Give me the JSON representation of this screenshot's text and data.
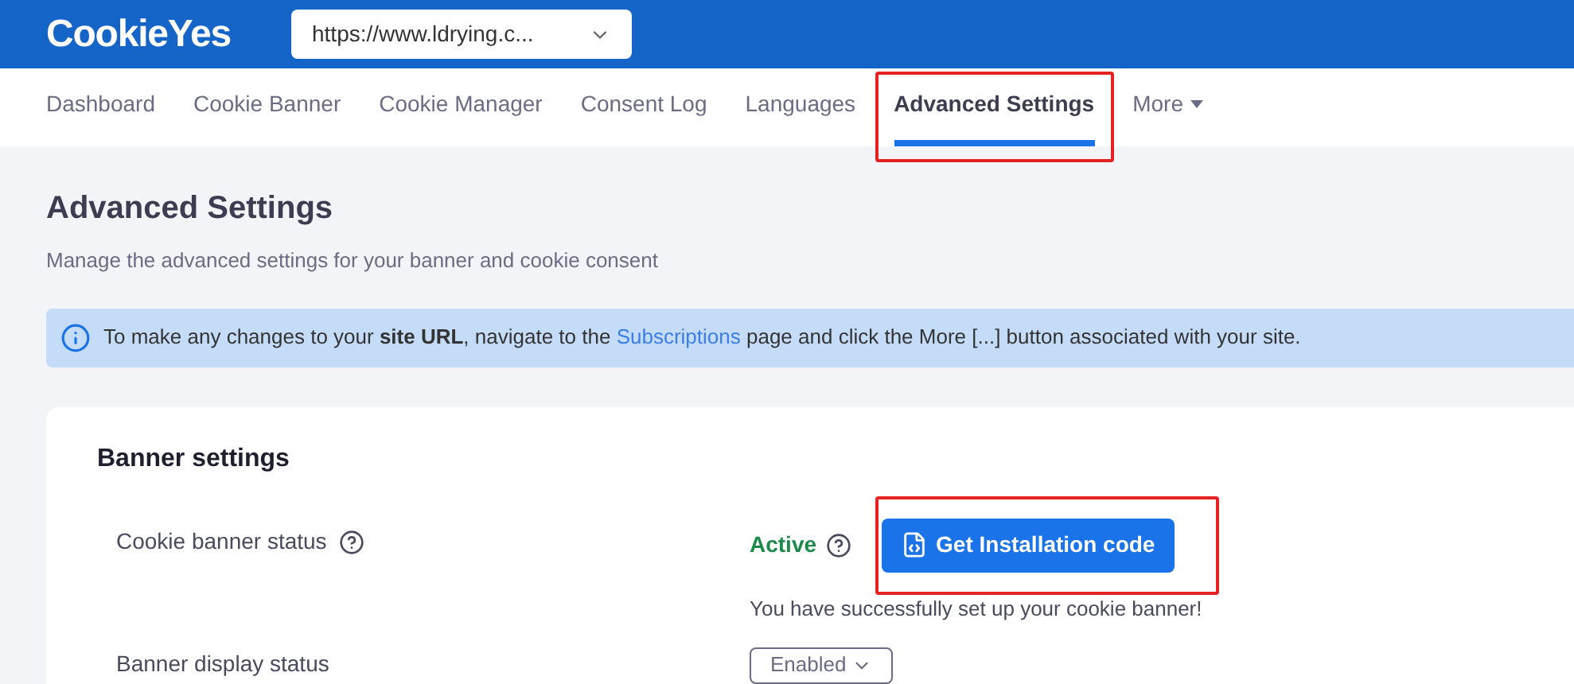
{
  "header": {
    "logo": "CookieYes",
    "site_select": {
      "value": "https://www.ldrying.c..."
    }
  },
  "tabs": [
    {
      "label": "Dashboard",
      "selected": false,
      "highlighted": false,
      "kind": "link"
    },
    {
      "label": "Cookie Banner",
      "selected": false,
      "highlighted": false,
      "kind": "link"
    },
    {
      "label": "Cookie Manager",
      "selected": false,
      "highlighted": false,
      "kind": "link"
    },
    {
      "label": "Consent Log",
      "selected": false,
      "highlighted": false,
      "kind": "link"
    },
    {
      "label": "Languages",
      "selected": false,
      "highlighted": false,
      "kind": "link"
    },
    {
      "label": "Advanced Settings",
      "selected": true,
      "highlighted": true,
      "kind": "link"
    },
    {
      "label": "More",
      "selected": false,
      "highlighted": false,
      "kind": "menu"
    }
  ],
  "page": {
    "title": "Advanced Settings",
    "subtitle": "Manage the advanced settings for your banner and cookie consent"
  },
  "notice": {
    "before": "To make any changes to your **site URL**, navigate to the",
    "link": "Subscriptions",
    "after": "page and click the More [...] button associated with your site."
  },
  "banner_settings": {
    "title": "Banner settings",
    "status_row": {
      "label": "Cookie banner status",
      "status": "Active",
      "button": {
        "label": "Get Installation code",
        "highlighted": true
      },
      "message": "You have successfully set up your cookie banner!"
    },
    "display_row": {
      "label": "Banner display status",
      "value": "Enabled"
    }
  }
}
